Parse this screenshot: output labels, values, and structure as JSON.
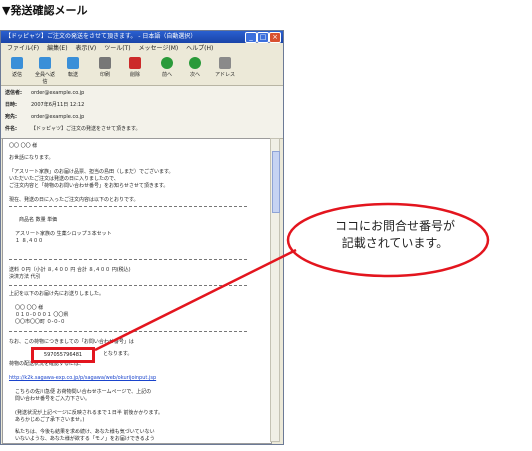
{
  "heading": "▼発送確認メール",
  "window": {
    "title": "【ドッピャツ】ご注文の発送をさせて頂きます。 - 日本語（自動選択）",
    "menu": [
      "ファイル(F)",
      "編集(E)",
      "表示(V)",
      "ツール(T)",
      "メッセージ(M)",
      "ヘルプ(H)"
    ],
    "toolbar": [
      {
        "label": "返信",
        "color": "#3a8fd8"
      },
      {
        "label": "全員へ返信",
        "color": "#3a8fd8"
      },
      {
        "label": "転送",
        "color": "#3a8fd8"
      },
      {
        "label": "印刷",
        "color": "#666666"
      },
      {
        "label": "削除",
        "color": "#cc2a2a"
      },
      {
        "label": "前へ",
        "color": "#2a9a3a"
      },
      {
        "label": "次へ",
        "color": "#2a9a3a"
      },
      {
        "label": "アドレス",
        "color": "#8a8a8a"
      }
    ],
    "headers": [
      {
        "label": "送信者:",
        "value": "order@example.co.jp"
      },
      {
        "label": "日時:",
        "value": "2007年6月11日 12:12"
      },
      {
        "label": "宛先:",
        "value": "order@example.co.jp"
      },
      {
        "label": "件名:",
        "value": "【ドッピャツ】ご注文の発送をさせて頂きます。"
      }
    ]
  },
  "mail_body": {
    "greeting": "〇〇 〇〇 様",
    "lines": [
      "お世話になります。",
      "「アスリート家族」のお届け品票、担当の島田（しまだ）でございます。",
      "いただいたご注文は発送の日に入りましたので、",
      "ご注文内容と「荷物のお問い合わせ番号」をお知らせさせて頂きます。",
      "現在、発送の日に入ったご注文内容は以下のとおりです。",
      "商品名 数量 単価",
      "アスリート家族の 生薬シロップ３本セット",
      "１ ８,４００",
      "送料 ０円（小計 ８,４００ 円 合計 ８,４００ 円(税込)",
      "決済方法 代引",
      "上記を以下のお届け先にお送りしました。",
      "〇〇 〇〇 様",
      "０１０-０００１ 〇〇県",
      "〇〇市〇〇町 ０-０-０",
      "なお、この荷物につきましての「お問い合わせ番号」は",
      "となります。",
      "荷物の配送状況を確認するには、",
      "http://k2k.sagawa-exp.co.jp/p/sagawa/web/okurijoinput.jsp",
      "こちらの佐川急便 お荷物問い合わせホームページで、上記の",
      "問い合わせ番号をご入力下さい。",
      "(発送状況が上記ページに反映されるまで１日半 前後かかります。",
      "あらかじめご了承下さいませ。)",
      "私たちは、今後も結果を求め続け、あなた様も気づいていない",
      "いないような、あなた様が欲する「モノ」をお届けできるよう"
    ],
    "tracking_number": "597055796481"
  },
  "callout": {
    "line1": "ココにお問合せ番号が",
    "line2": "記載されています。",
    "color": "#e3151e"
  }
}
